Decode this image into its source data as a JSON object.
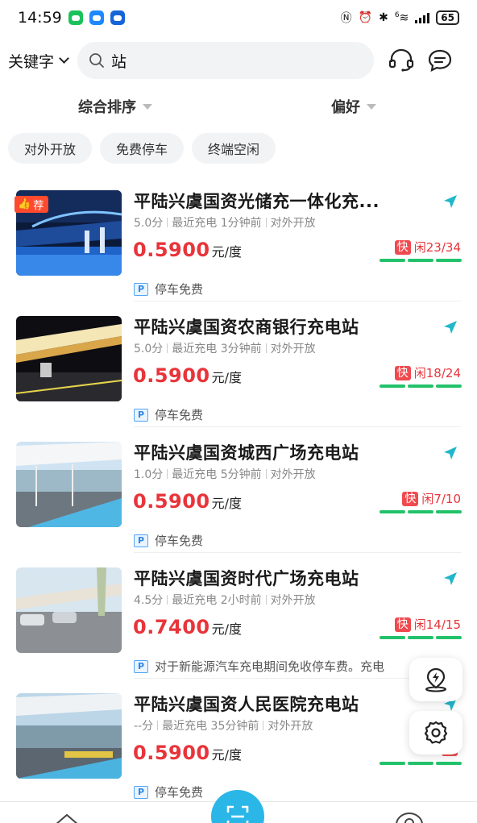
{
  "status_bar": {
    "time": "14:59",
    "network": "6",
    "battery": "65"
  },
  "search": {
    "mode_label": "关键字",
    "value": "站",
    "placeholder": ""
  },
  "sort": {
    "composite": "综合排序",
    "preference": "偏好"
  },
  "filters": [
    "对外开放",
    "免费停车",
    "终端空闲"
  ],
  "recommend_label": "荐",
  "stations": [
    {
      "name": "平陆兴虞国资光储充一体化充...",
      "score": "5.0分",
      "last_charge": "最近充电 1分钟前",
      "access": "对外开放",
      "price": "0.5900",
      "unit": "元/度",
      "fast_tag": "快",
      "idle": "闲23/34",
      "parking": "停车免费",
      "recommended": true
    },
    {
      "name": "平陆兴虞国资农商银行充电站",
      "score": "5.0分",
      "last_charge": "最近充电 3分钟前",
      "access": "对外开放",
      "price": "0.5900",
      "unit": "元/度",
      "fast_tag": "快",
      "idle": "闲18/24",
      "parking": "停车免费",
      "recommended": false
    },
    {
      "name": "平陆兴虞国资城西广场充电站",
      "score": "1.0分",
      "last_charge": "最近充电 5分钟前",
      "access": "对外开放",
      "price": "0.5900",
      "unit": "元/度",
      "fast_tag": "快",
      "idle": "闲7/10",
      "parking": "停车免费",
      "recommended": false
    },
    {
      "name": "平陆兴虞国资时代广场充电站",
      "score": "4.5分",
      "last_charge": "最近充电 2小时前",
      "access": "对外开放",
      "price": "0.7400",
      "unit": "元/度",
      "fast_tag": "快",
      "idle": "闲14/15",
      "parking": "对于新能源汽车充电期间免收停车费。充电",
      "recommended": false
    },
    {
      "name": "平陆兴虞国资人民医院充电站",
      "score": "--分",
      "last_charge": "最近充电 35分钟前",
      "access": "对外开放",
      "price": "0.5900",
      "unit": "元/度",
      "fast_tag": "快",
      "idle": "",
      "parking": "停车免费",
      "recommended": false
    }
  ],
  "colors": {
    "price": "#e8343a",
    "bars": "#22c26a",
    "accent": "#2bb6e8",
    "nav_arrow": "#1fb7c9"
  },
  "icons": {
    "search": "search-icon",
    "service": "headset-icon",
    "message": "message-icon",
    "navigate": "navigate-arrow-icon",
    "location_charge": "location-charge-icon",
    "settings": "gear-icon",
    "scan": "scan-icon"
  }
}
